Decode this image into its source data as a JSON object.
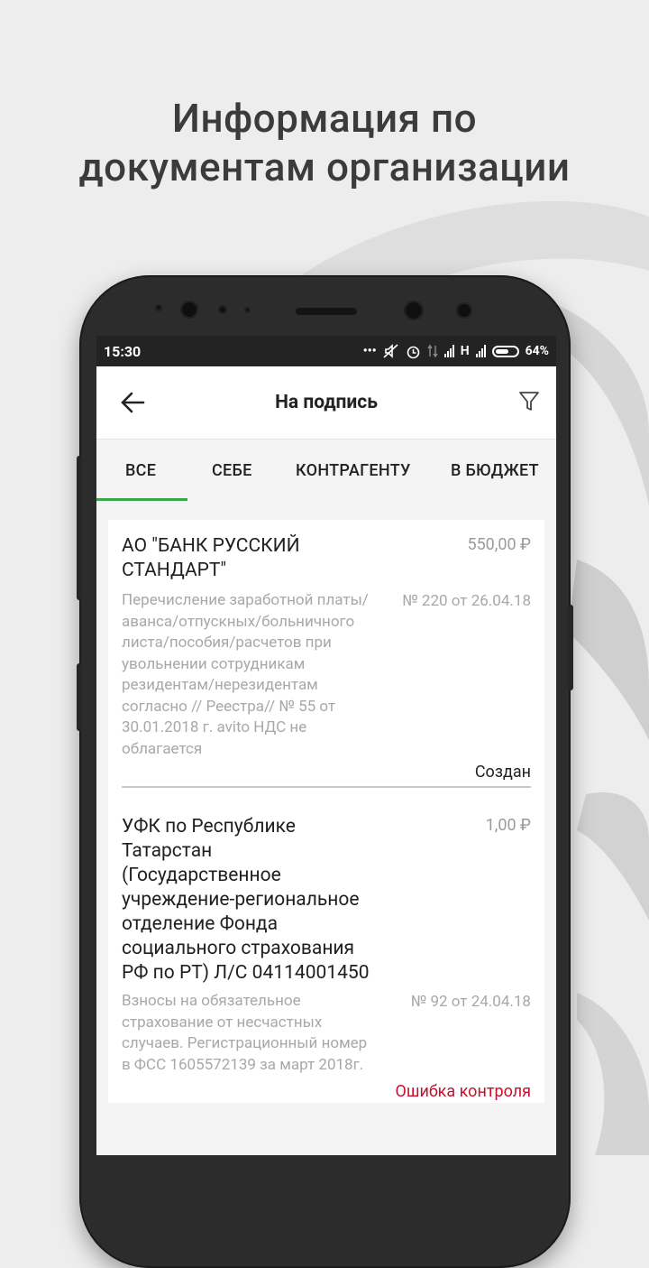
{
  "promo": {
    "headline_line1": "Информация по",
    "headline_line2": "документам организации"
  },
  "statusbar": {
    "time": "15:30",
    "network": "H",
    "battery": "64%"
  },
  "appbar": {
    "title": "На подпись"
  },
  "tabs": [
    {
      "label": "ВСЕ",
      "active": true
    },
    {
      "label": "СЕБЕ",
      "active": false
    },
    {
      "label": "КОНТРАГЕНТУ",
      "active": false
    },
    {
      "label": "В БЮДЖЕТ",
      "active": false
    }
  ],
  "documents": [
    {
      "payee": "АО \"БАНК РУССКИЙ СТАНДАРТ\"",
      "amount": "550,00 ₽",
      "purpose": "Перечисление заработной платы/аванса/отпускных/больничного листа/пособия/расчетов при увольнении сотрудникам резидентам/нерезидентам согласно // Реестра// № 55 от 30.01.2018 г.  avito НДС не облагается",
      "doc_number": "№ 220 от 26.04.18",
      "status": "Создан"
    },
    {
      "payee": "УФК по Республике Татарстан (Государственное учреждение-региональное отделение Фонда социального страхования РФ по РТ) Л/С 04114001450",
      "amount": "1,00 ₽",
      "purpose": "Взносы на обязательное страхование от несчастных случаев. Регистрационный номер в ФСС 1605572139 за март 2018г.",
      "doc_number": "№ 92 от 24.04.18",
      "status": "Ошибка контроля"
    }
  ],
  "colors": {
    "accent": "#3aa84a",
    "error": "#c8102e"
  }
}
